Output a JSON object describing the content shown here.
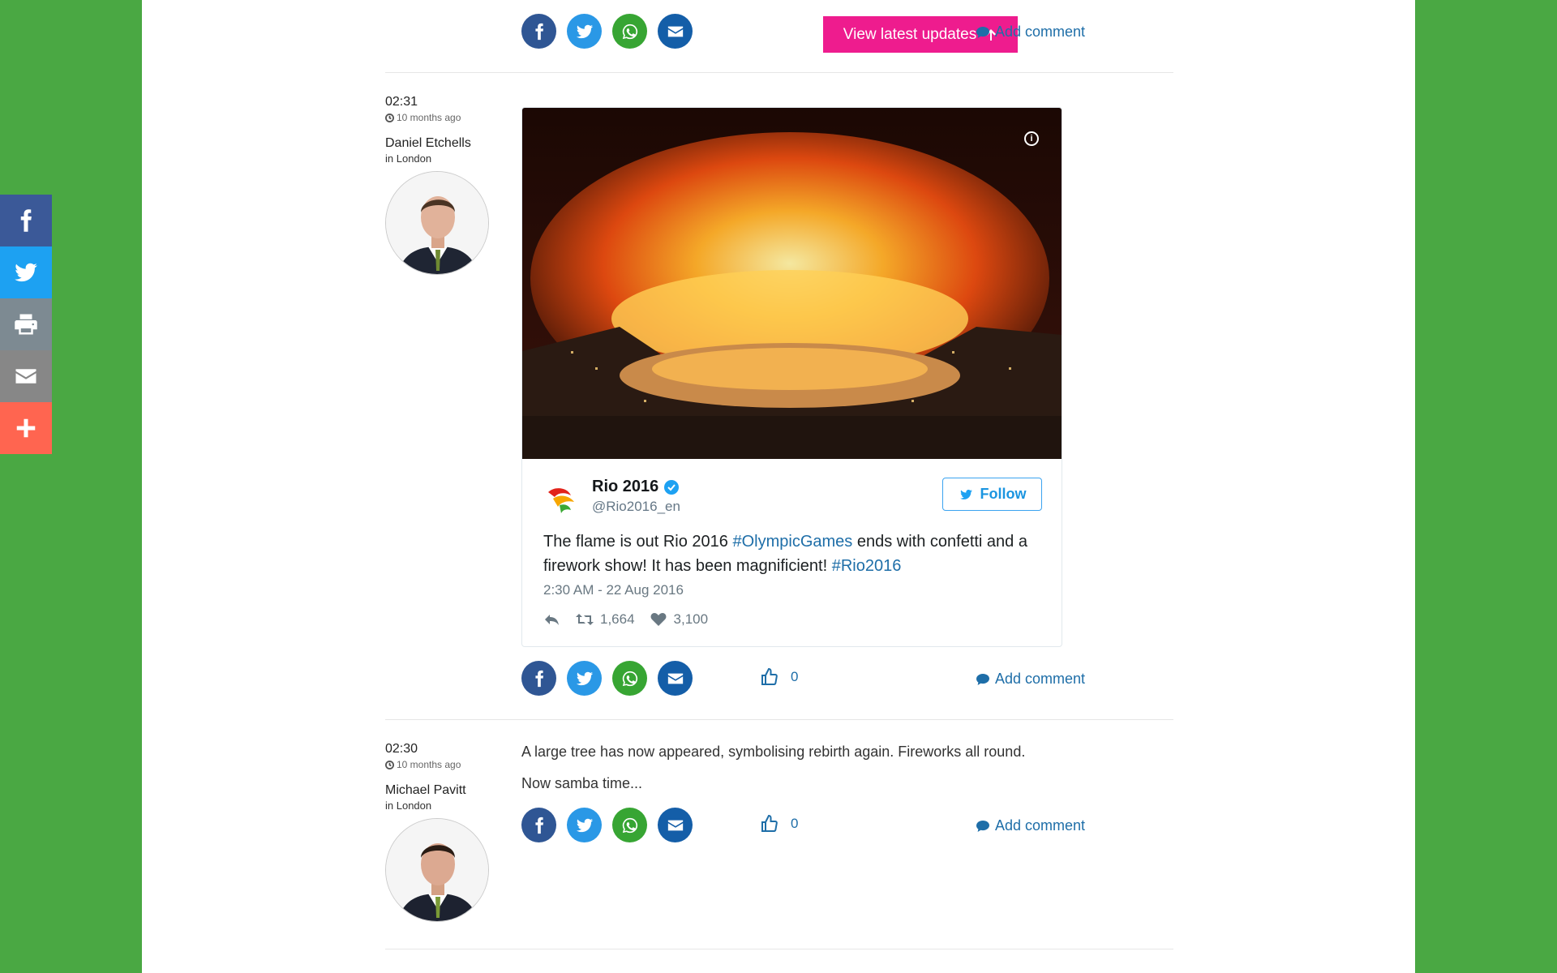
{
  "float_share": {
    "icons": [
      "facebook-icon",
      "twitter-icon",
      "print-icon",
      "email-icon",
      "plus-icon"
    ]
  },
  "top_bar": {
    "updates_label": "View latest updates",
    "add_comment": "Add comment"
  },
  "posts": [
    {
      "time": "02:31",
      "ago": "10 months ago",
      "author": "Daniel Etchells",
      "location": "in London",
      "tweet": {
        "name": "Rio 2016",
        "handle": "@Rio2016_en",
        "follow_label": "Follow",
        "text_1": "The flame is out Rio 2016 ",
        "hashtag_1": "#OlympicGames",
        "text_2": " ends with confetti and a firework show! It has been magnificient! ",
        "hashtag_2": "#Rio2016",
        "date": "2:30 AM - 22 Aug 2016",
        "retweets": "1,664",
        "likes": "3,100"
      },
      "like_count": "0",
      "add_comment": "Add comment"
    },
    {
      "time": "02:30",
      "ago": "10 months ago",
      "author": "Michael Pavitt",
      "location": "in London",
      "paragraph_1": "A large tree has now appeared, symbolising rebirth again. Fireworks all round.",
      "paragraph_2": "Now samba time...",
      "like_count": "0",
      "add_comment": "Add comment"
    }
  ],
  "colors": {
    "background": "#4aa843",
    "accent_pink": "#ee1c8e",
    "link_blue": "#1e6ea8"
  }
}
